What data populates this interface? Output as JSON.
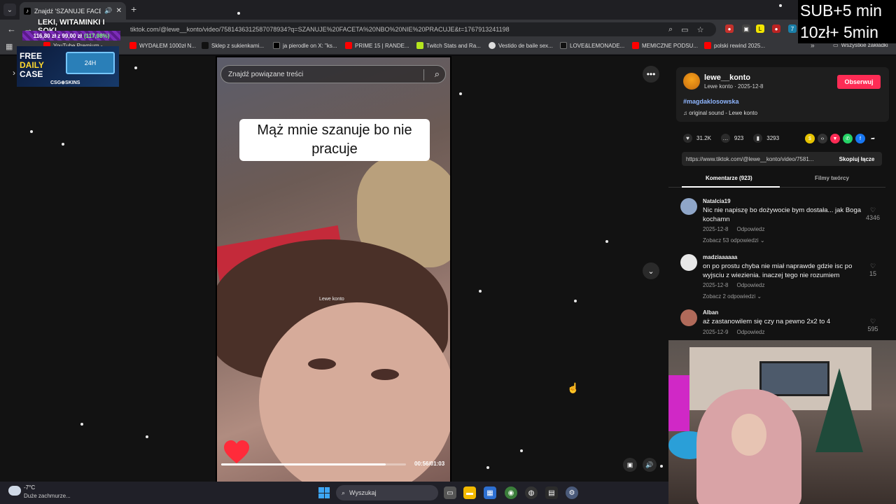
{
  "browser": {
    "tab_title": "Znajdź 'SZANUJE FACETA N",
    "tab_favicon": "tiktok-icon",
    "url": "tiktok.com/@lewe__konto/video/7581436312587078934?q=SZANUJE%20FACETA%20NBO%20NIE%20PRACUJE&t=1767913241198",
    "bookmarks": [
      {
        "label": "YouTube Premium -...",
        "color": "#ff0000"
      },
      {
        "label": "WYDAŁEM 1000zł N...",
        "color": "#ff0000"
      },
      {
        "label": "Sklep z sukienkami...",
        "color": "#111111"
      },
      {
        "label": "ja pierodle on X: \"ks...",
        "color": "#000000"
      },
      {
        "label": "PRIME 15 | RANDE...",
        "color": "#ff0000"
      },
      {
        "label": "Twitch Stats and Ra...",
        "color": "#b5e61d"
      },
      {
        "label": "Vestido de baile sex...",
        "color": "#dddddd"
      },
      {
        "label": "LOVE&LEMONADE...",
        "color": "#111111"
      },
      {
        "label": "MEMICZNE PODSU...",
        "color": "#ff0000"
      },
      {
        "label": "polski rewind 2025...",
        "color": "#ff0000"
      }
    ],
    "all_bookmarks_label": "Wszystkie zakładki"
  },
  "overlay": {
    "sub_line1": "SUB+5 min",
    "sub_line2": "10zł+ 5min"
  },
  "promo": {
    "headline": "LEKI, WITAMINKI I SOKI",
    "price": "116,80 zł z 99,00 zł",
    "percent": "(117,98%)",
    "free_line1": "FREE",
    "free_line2": "DAILY",
    "free_line3": "CASE",
    "box_label": "24H",
    "brand": "CSG⊕SKINS"
  },
  "video": {
    "search_placeholder": "Znajdź powiązane treści",
    "caption": "Mąż mnie szanuje bo nie pracuje",
    "watermark": "Lewe konto",
    "progress": 0.89,
    "time": "00:56/01:03"
  },
  "author": {
    "username": "lewe__konto",
    "subline": "Lewe konto · 2025-12-8",
    "follow_label": "Obserwuj",
    "hashtag": "#magdaklosowska",
    "sound": "original sound - Lewe konto"
  },
  "stats": {
    "likes": "31.2K",
    "comments": "923",
    "saves": "3293"
  },
  "share": {
    "link": "https://www.tiktok.com/@lewe__konto/video/7581...",
    "copy_label": "Skopiuj łącze"
  },
  "tabs": {
    "comments": "Komentarze (923)",
    "creator_videos": "Filmy twórcy"
  },
  "comments": [
    {
      "name": "Natalcia19",
      "text": "Nic nie napiszę bo dożywocie bym dostała... jak Boga kochamn",
      "date": "2025-12-8",
      "reply": "Odpowiedz",
      "replies": "Zobacz 53 odpowiedzi ⌄",
      "likes": "4346",
      "avatar_color": "#8fa6c8"
    },
    {
      "name": "madziaaaaaa",
      "text": "on po prostu chyba nie miał naprawde gdzie isc po wyjsciu z wiezienia. inaczej tego nie rozumiem",
      "date": "2025-12-8",
      "reply": "Odpowiedz",
      "replies": "Zobacz 2 odpowiedzi ⌄",
      "likes": "15",
      "avatar_color": "#e8e8e8"
    },
    {
      "name": "Alban",
      "text": "aż zastanowilem się czy na pewno 2x2 to 4",
      "date": "2025-12-9",
      "reply": "Odpowiedz",
      "replies": "",
      "likes": "595",
      "avatar_color": "#b06a5a"
    }
  ],
  "taskbar": {
    "temp": "-7°C",
    "weather": "Duże zachmurze...",
    "search": "Wyszukaj"
  }
}
